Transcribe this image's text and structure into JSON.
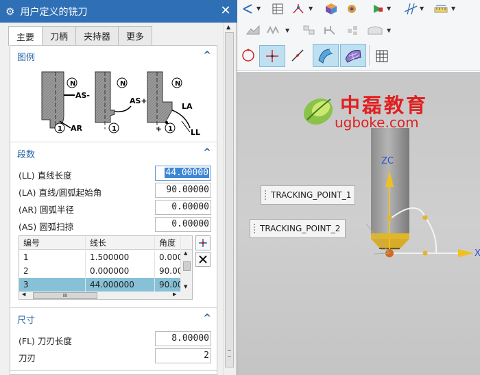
{
  "dialog": {
    "title": "用户定义的铣刀",
    "tabs": [
      "主要",
      "刀柄",
      "夹持器",
      "更多"
    ],
    "sections": {
      "illustration": "图例",
      "segments": "段数",
      "dimensions": "尺寸"
    },
    "diagram_labels": {
      "n": "N",
      "one": "1",
      "as_minus": "AS-",
      "as_plus": "AS+",
      "ar": "AR",
      "la": "LA",
      "ll": "LL",
      "plus": "+"
    },
    "params": [
      {
        "label": "(LL) 直线长度",
        "value": "44.00000"
      },
      {
        "label": "(LA) 直线/圆弧起始角",
        "value": "90.00000"
      },
      {
        "label": "(AR) 圆弧半径",
        "value": "0.00000"
      },
      {
        "label": "(AS) 圆弧扫掠",
        "value": "0.00000"
      }
    ],
    "grid": {
      "headers": [
        "编号",
        "线长",
        "角度"
      ],
      "rows": [
        [
          "1",
          "1.500000",
          "0.000"
        ],
        [
          "2",
          "0.000000",
          "90.00"
        ],
        [
          "3",
          "44.000000",
          "90.00"
        ]
      ],
      "selected_row": 3,
      "hscroll_label": "III"
    },
    "dims": [
      {
        "label": "(FL) 刀刃长度",
        "value": "8.00000"
      },
      {
        "label": "刀刃",
        "value": "2"
      }
    ]
  },
  "viewport": {
    "watermark_cn": "中磊教育",
    "watermark_en": "ugboke.com",
    "axis_z": "ZC",
    "axis_x": "X",
    "tracking_points": [
      "TRACKING_POINT_1",
      "TRACKING_POINT_2"
    ]
  },
  "toolbar_icons": [
    "transform-icon",
    "table-icon",
    "branch-icon",
    "cube-icon",
    "gear-cube-icon",
    "play-icon",
    "ruler-icon",
    "zigzag-icon",
    "mold-icon",
    "stack-icon",
    "grid-icon",
    "circle-icon",
    "point-icon",
    "line-icon",
    "surface-icon",
    "mesh-icon",
    "hatch-icon"
  ],
  "colors": {
    "title_bar": "#2f6fb5",
    "section_text": "#2563a8",
    "selected_row": "#87c1d8",
    "watermark_red": "#e02020",
    "axis_yellow": "#f0c020"
  }
}
